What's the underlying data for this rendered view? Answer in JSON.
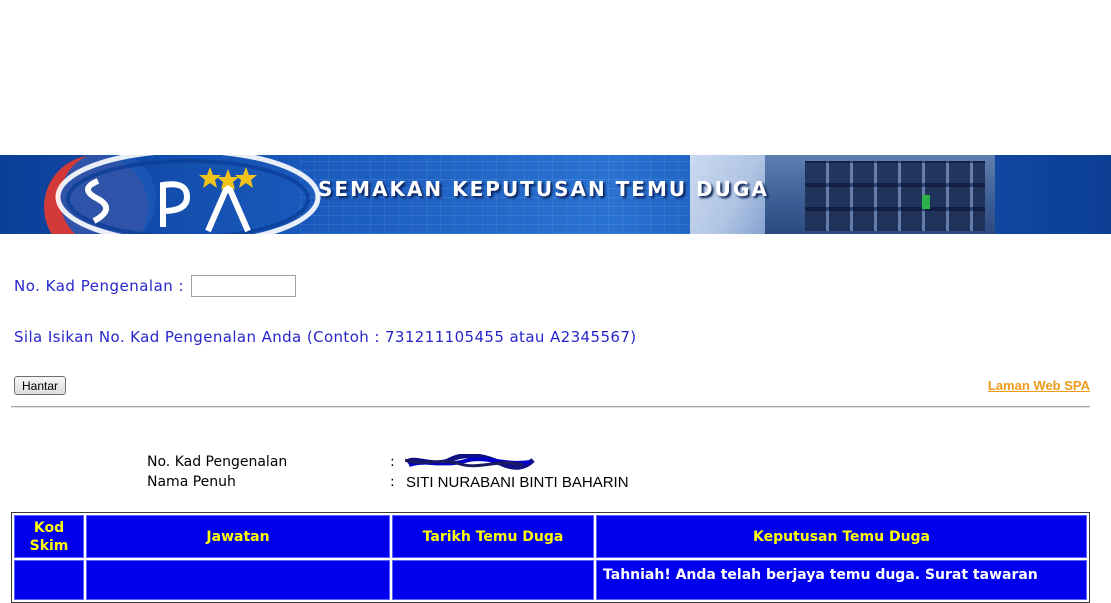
{
  "banner": {
    "title": "SEMAKAN KEPUTUSAN TEMU DUGA",
    "logo_text": "SPA"
  },
  "form": {
    "ic_label": "No. Kad Pengenalan :",
    "ic_value": "",
    "hint": "Sila Isikan No. Kad Pengenalan Anda (Contoh : 731211105455 atau A2345567)",
    "submit_label": "Hantar",
    "link_label": "Laman Web SPA"
  },
  "details": {
    "ic_label": "No. Kad Pengenalan",
    "name_label": "Nama Penuh",
    "separator": ":",
    "name_value": "SITI NURABANI BINTI BAHARIN"
  },
  "table": {
    "headers": [
      "Kod\nSkim",
      "Jawatan",
      "Tarikh Temu Duga",
      "Keputusan Temu Duga"
    ],
    "rows": [
      [
        "",
        "",
        "",
        "Tahniah! Anda telah berjaya temu duga. Surat tawaran"
      ]
    ]
  },
  "colors": {
    "accent_blue": "#0000ee",
    "header_text": "#ffff00",
    "label_blue": "#2626cc",
    "link_orange": "#f09a1a"
  }
}
